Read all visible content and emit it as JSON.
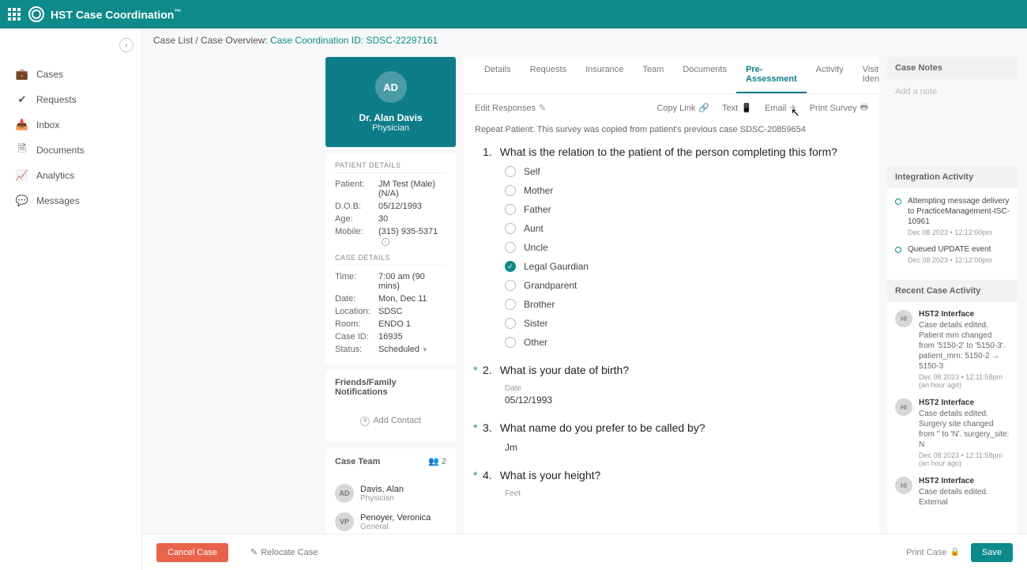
{
  "brand": "HST Case Coordination",
  "sidebar": {
    "items": [
      {
        "label": "Cases"
      },
      {
        "label": "Requests"
      },
      {
        "label": "Inbox"
      },
      {
        "label": "Documents"
      },
      {
        "label": "Analytics"
      },
      {
        "label": "Messages"
      }
    ]
  },
  "breadcrumb": {
    "root": "Case List",
    "sep": " / ",
    "mid": "Case Overview: ",
    "link": "Case Coordination ID: SDSC-22297161"
  },
  "profile": {
    "initials": "AD",
    "name": "Dr. Alan Davis",
    "role": "Physician"
  },
  "patient_details_hdr": "PATIENT DETAILS",
  "patient": {
    "patient_k": "Patient:",
    "patient_v": "JM Test (Male)(N/A)",
    "dob_k": "D.O.B:",
    "dob_v": "05/12/1993",
    "age_k": "Age:",
    "age_v": "30",
    "mobile_k": "Mobile:",
    "mobile_v": "(315) 935-5371"
  },
  "case_details_hdr": "CASE DETAILS",
  "casedet": {
    "time_k": "Time:",
    "time_v": "7:00 am (90 mins)",
    "date_k": "Date:",
    "date_v": "Mon, Dec 11",
    "loc_k": "Location:",
    "loc_v": "SDSC",
    "room_k": "Room:",
    "room_v": "ENDO 1",
    "cid_k": "Case ID:",
    "cid_v": "16935",
    "status_k": "Status:",
    "status_v": "Scheduled"
  },
  "friends_hdr": "Friends/Family Notifications",
  "add_contact": "Add Contact",
  "caseteam_hdr": "Case Team",
  "caseteam_count": "2",
  "team": [
    {
      "initials": "AD",
      "name": "Davis, Alan",
      "role": "Physician"
    },
    {
      "initials": "VP",
      "name": "Penoyer, Veronica",
      "role": "General"
    }
  ],
  "tabs": [
    "Details",
    "Requests",
    "Insurance",
    "Team",
    "Documents",
    "Pre-Assessment",
    "Activity",
    "Visit Identifiers"
  ],
  "active_tab": "Pre-Assessment",
  "tools": {
    "edit": "Edit Responses",
    "copylink": "Copy Link",
    "text": "Text",
    "email": "Email",
    "print": "Print Survey"
  },
  "repeat_note": "Repeat Patient: This survey was copied from patient's previous case SDSC-20859654",
  "q1": {
    "num": "1.",
    "text": "What is the relation to the patient of the person completing this form?",
    "options": [
      "Self",
      "Mother",
      "Father",
      "Aunt",
      "Uncle",
      "Legal Gaurdian",
      "Grandparent",
      "Brother",
      "Sister",
      "Other"
    ],
    "selected": "Legal Gaurdian"
  },
  "q2": {
    "num": "2.",
    "text": "What is your date of birth?",
    "label": "Date",
    "value": "05/12/1993"
  },
  "q3": {
    "num": "3.",
    "text": "What name do you prefer to be called by?",
    "value": "Jm"
  },
  "q4": {
    "num": "4.",
    "text": "What is your height?",
    "label": "Feet"
  },
  "notes_hdr": "Case Notes",
  "notes_placeholder": "Add a note",
  "integration_hdr": "Integration Activity",
  "integration": [
    {
      "msg": "Attempting message delivery to PracticeManagement-ISC-10961",
      "ts": "Dec 08 2023 • 12:12:00pm"
    },
    {
      "msg": "Queued UPDATE event",
      "ts": "Dec 08 2023 • 12:12:00pm"
    }
  ],
  "recent_hdr": "Recent Case Activity",
  "recent": [
    {
      "av": "HI",
      "who": "HST2 Interface",
      "what": "Case details edited. Patient mrn changed from '5150-2' to '5150-3'. patient_mrn: 5150-2 → 5150-3",
      "ts": "Dec 08 2023 • 12:11:58pm (an hour ago)"
    },
    {
      "av": "HI",
      "who": "HST2 Interface",
      "what": "Case details edited. Surgery site changed from '' to 'N'. surgery_site: N",
      "ts": "Dec 08 2023 • 12:11:58pm (an hour ago)"
    },
    {
      "av": "HI",
      "who": "HST2 Interface",
      "what": "Case details edited. External",
      "ts": ""
    }
  ],
  "footer": {
    "cancel": "Cancel Case",
    "relocate": "Relocate Case",
    "printcase": "Print Case",
    "save": "Save"
  }
}
